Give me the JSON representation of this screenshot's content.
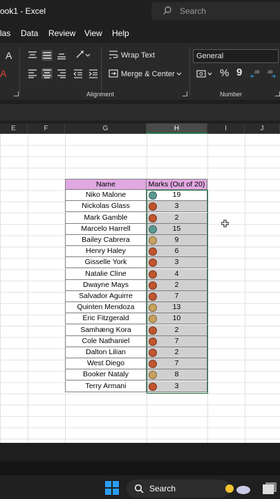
{
  "window": {
    "title": "ook1  -  Excel",
    "search_placeholder": "Search",
    "search_icon": "search-icon"
  },
  "menu": {
    "tabs": [
      "las",
      "Data",
      "Review",
      "View",
      "Help"
    ]
  },
  "ribbon": {
    "wrap_text": "Wrap Text",
    "merge_center": "Merge & Center",
    "number_format": "General",
    "alignment_label": "Alignment",
    "number_label": "Number",
    "font_a_label": "A",
    "percent_label": "%",
    "comma_label": "9"
  },
  "columns": [
    "E",
    "F",
    "G",
    "H",
    "I",
    "J"
  ],
  "selected_column": "H",
  "table": {
    "headers": {
      "name": "Name",
      "marks": "Marks (Out of 20)"
    },
    "rows": [
      {
        "name": "Niko Malone",
        "mark": "19",
        "dot": "#5a9a92"
      },
      {
        "name": "Nickolas Glass",
        "mark": "3",
        "dot": "#c0552e"
      },
      {
        "name": "Mark Gamble",
        "mark": "2",
        "dot": "#c0552e"
      },
      {
        "name": "Marcelo Harrell",
        "mark": "15",
        "dot": "#5a9a92"
      },
      {
        "name": "Bailey Cabrera",
        "mark": "9",
        "dot": "#c9a15e"
      },
      {
        "name": "Henry Haley",
        "mark": "6",
        "dot": "#c0552e"
      },
      {
        "name": "Gisselle York",
        "mark": "3",
        "dot": "#c0552e"
      },
      {
        "name": "Natalie Cline",
        "mark": "4",
        "dot": "#c0552e"
      },
      {
        "name": "Dwayne Mays",
        "mark": "2",
        "dot": "#c0552e"
      },
      {
        "name": "Salvador Aguirre",
        "mark": "7",
        "dot": "#c0552e"
      },
      {
        "name": "Quinten Mendoza",
        "mark": "13",
        "dot": "#c9a15e"
      },
      {
        "name": "Eric Fitzgerald",
        "mark": "10",
        "dot": "#c9a15e"
      },
      {
        "name": "Samhæng Kora",
        "mark": "2",
        "dot": "#c0552e"
      },
      {
        "name": "Cole Nathaniel",
        "mark": "7",
        "dot": "#c0552e"
      },
      {
        "name": "Dalton Lilian",
        "mark": "2",
        "dot": "#c0552e"
      },
      {
        "name": "West Diego",
        "mark": "7",
        "dot": "#c0552e"
      },
      {
        "name": "Booker Nataly",
        "mark": "8",
        "dot": "#c9a15e"
      },
      {
        "name": "Terry Armani",
        "mark": "3",
        "dot": "#c0552e"
      }
    ]
  },
  "taskbar": {
    "search_label": "Search",
    "start_icon": "windows-start-icon"
  },
  "colors": {
    "header_fill": "#e0a8e0",
    "selected_fill": "#d0d0d0",
    "selection_border": "#217346"
  }
}
